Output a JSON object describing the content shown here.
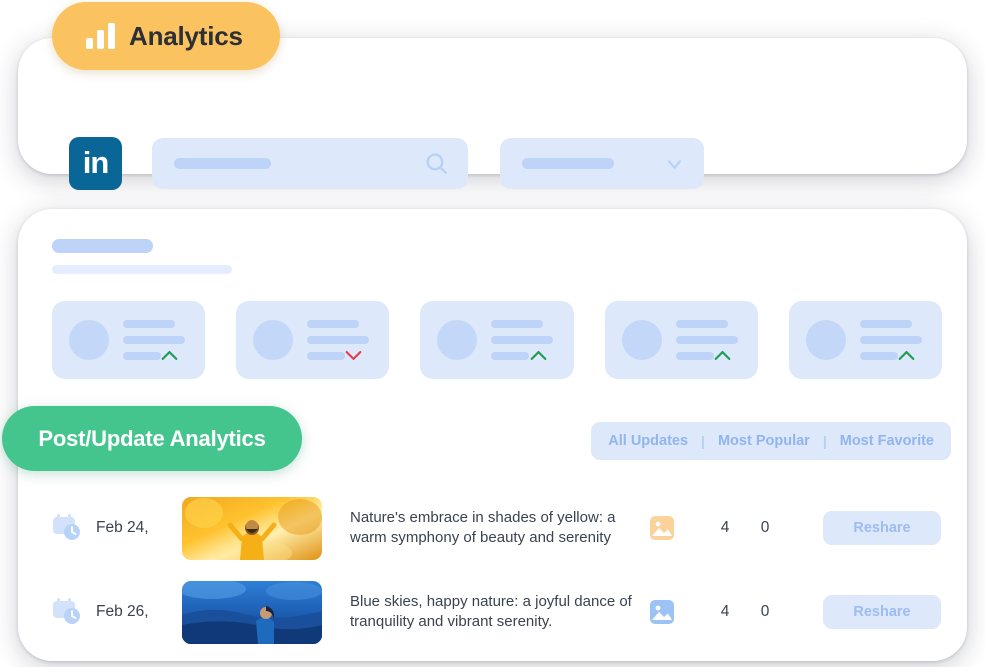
{
  "badges": {
    "analytics": {
      "label": "Analytics",
      "icon": "bar-chart-icon",
      "color": "#fbc35f"
    },
    "post_update": {
      "label": "Post/Update Analytics",
      "color": "#44c58e"
    }
  },
  "header": {
    "network_icon": "linkedin-icon",
    "network_name": "in",
    "network_color": "#0b6698",
    "search": {
      "icon": "search-icon",
      "placeholder": ""
    },
    "dropdown": {
      "icon": "chevron-down-icon",
      "value": ""
    }
  },
  "stat_cards": [
    {
      "trend": "up",
      "trend_icon": "chevron-up-icon",
      "trend_color": "#1f9d55"
    },
    {
      "trend": "down",
      "trend_icon": "chevron-down-icon",
      "trend_color": "#e0414c"
    },
    {
      "trend": "up",
      "trend_icon": "chevron-up-icon",
      "trend_color": "#1f9d55"
    },
    {
      "trend": "up",
      "trend_icon": "chevron-up-icon",
      "trend_color": "#1f9d55"
    },
    {
      "trend": "up",
      "trend_icon": "chevron-up-icon",
      "trend_color": "#1f9d55"
    }
  ],
  "filters": {
    "items": [
      {
        "label": "All Updates"
      },
      {
        "label": "Most Popular"
      },
      {
        "label": "Most Favorite"
      }
    ],
    "separator": "|"
  },
  "table": {
    "rows": [
      {
        "date": "Feb 24,",
        "date_icon": "calendar-clock-icon",
        "thumbnail": "autumn-yellow-photo",
        "text": "Nature's embrace in shades of yellow: a warm symphony of beauty and serenity",
        "media_icon": "image-icon",
        "media_icon_color": "#fbd39a",
        "count_reactions": "4",
        "count_comments": "0",
        "action_label": "Reshare"
      },
      {
        "date": "Feb 26,",
        "date_icon": "calendar-clock-icon",
        "thumbnail": "blue-nature-photo",
        "text": "Blue skies, happy nature: a joyful dance of tranquility and vibrant serenity.",
        "media_icon": "image-icon",
        "media_icon_color": "#9dc2f5",
        "count_reactions": "4",
        "count_comments": "0",
        "action_label": "Reshare"
      }
    ]
  }
}
